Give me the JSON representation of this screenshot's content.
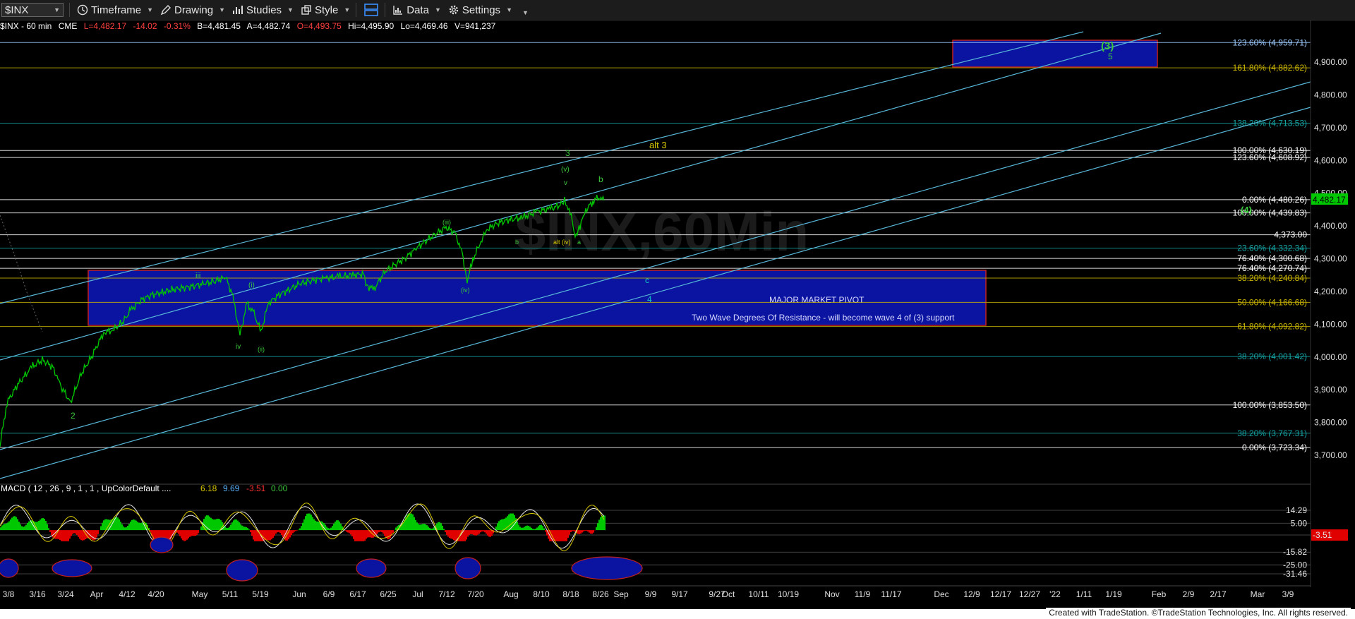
{
  "toolbar": {
    "symbol": "$INX",
    "timeframe": "Timeframe",
    "drawing": "Drawing",
    "studies": "Studies",
    "style": "Style",
    "data": "Data",
    "settings": "Settings"
  },
  "info": {
    "name": "$INX - 60 min",
    "exchange": "CME",
    "last": "L=4,482.17",
    "change": "-14.02",
    "pct": "-0.31%",
    "bid": "B=4,481.45",
    "ask": "A=4,482.74",
    "open": "O=4,493.75",
    "high": "Hi=4,495.90",
    "low": "Lo=4,469.46",
    "volume": "V=941,237"
  },
  "watermark": "$INX,60Min",
  "price_axis": {
    "ticks": [
      "4,900.00",
      "4,800.00",
      "4,700.00",
      "4,600.00",
      "4,500.00",
      "4,400.00",
      "4,300.00",
      "4,200.00",
      "4,100.00",
      "4,000.00",
      "3,900.00",
      "3,800.00",
      "3,700.00"
    ],
    "last_price": "4,482.17"
  },
  "fib_levels": [
    {
      "label": "123.60% (4,959.71)",
      "color": "#9ecbff"
    },
    {
      "label": "161.80% (4,882.62)",
      "color": "#c8b400"
    },
    {
      "label": "138.20% (4,713.53)",
      "color": "#16a3a3"
    },
    {
      "label": "100.00% (4,630.19)",
      "color": "#ffffff"
    },
    {
      "label": "123.60% (4,608.92)",
      "color": "#ffffff"
    },
    {
      "label": "0.00% (4,480.26)",
      "color": "#ffffff"
    },
    {
      "label": "100.00% (4,439.83)",
      "color": "#ffffff"
    },
    {
      "label": "4,373.00",
      "color": "#ffffff"
    },
    {
      "label": "23.60% (4,332.34)",
      "color": "#16a3a3"
    },
    {
      "label": "76.40% (4,300.68)",
      "color": "#ffffff"
    },
    {
      "label": "76.40% (4,270.74)",
      "color": "#ffffff"
    },
    {
      "label": "38.20% (4,240.84)",
      "color": "#c8b400"
    },
    {
      "label": "50.00% (4,166.68)",
      "color": "#c8b400"
    },
    {
      "label": "61.80% (4,092.82)",
      "color": "#c8b400"
    },
    {
      "label": "38.20% (4,001.42)",
      "color": "#16a3a3"
    },
    {
      "label": "100.00% (3,853.50)",
      "color": "#ffffff"
    },
    {
      "label": "38.20% (3,767.31)",
      "color": "#16a3a3"
    },
    {
      "label": "0.00% (3,723.34)",
      "color": "#ffffff"
    }
  ],
  "boxes": {
    "pivot_title": "MAJOR MARKET PIVOT",
    "pivot_note": "Two Wave Degrees Of Resistance - will become wave 4 of (3) support"
  },
  "wave_labels": {
    "w3": "3",
    "w5": "5",
    "big3": "(3)",
    "big4": "(4)",
    "alt3": "alt 3",
    "b": "b",
    "c": "c",
    "w4": "4",
    "w2": "2",
    "iii": "iii",
    "iv": "iv",
    "i": "(i)",
    "ii": "(ii)",
    "iii2": "(iii)",
    "iv2": "(iv)",
    "v": "(v)",
    "vsm": "v",
    "altiv": "alt (iv)",
    "a": "a",
    "bsm": "b"
  },
  "macd": {
    "title": "MACD ( 12 , 26 , 9 , 1 , 1 , UpColorDefault ....",
    "v1": "6.18",
    "v2": "9.69",
    "v3": "-3.51",
    "v4": "0.00",
    "ticks": [
      "14.29",
      "5.00",
      "-3.51",
      "-15.82",
      "-25.00",
      "-31.46"
    ]
  },
  "date_axis": [
    "3/8",
    "3/16",
    "3/24",
    "Apr",
    "4/12",
    "4/20",
    "May",
    "5/11",
    "5/19",
    "Jun",
    "6/9",
    "6/17",
    "6/25",
    "Jul",
    "7/12",
    "7/20",
    "Aug",
    "8/10",
    "8/18",
    "8/26",
    "Sep",
    "9/9",
    "9/17",
    "9/27",
    "Oct",
    "10/11",
    "10/19",
    "Nov",
    "11/9",
    "11/17",
    "Dec",
    "12/9",
    "12/17",
    "12/27",
    "'22",
    "1/11",
    "1/19",
    "Feb",
    "2/9",
    "2/17",
    "Mar",
    "3/9"
  ],
  "footer": "Created with TradeStation. ©TradeStation Technologies, Inc. All rights reserved.",
  "colors": {
    "up": "#00c800",
    "down": "#e00000",
    "fib_cyan": "#16a3a3",
    "box": "#0a14a0"
  }
}
